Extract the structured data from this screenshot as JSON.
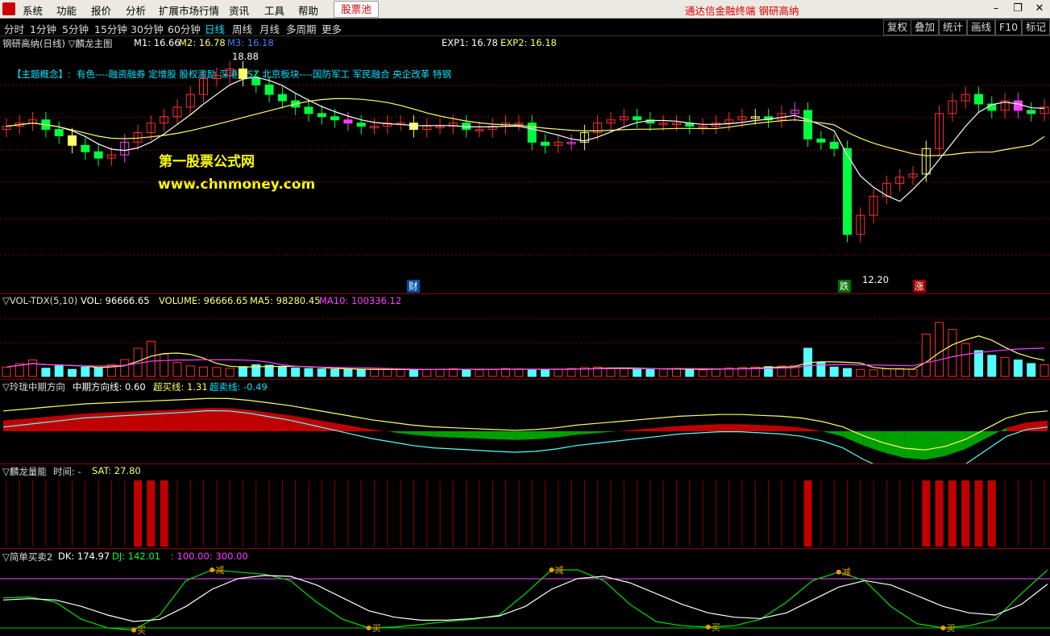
{
  "menu": {
    "items": [
      "系统",
      "功能",
      "报价",
      "分析",
      "扩展市场行情",
      "资讯",
      "工具",
      "帮助"
    ],
    "pool": "股票池",
    "right_title": "通达信金融终端  钢研高纳"
  },
  "periods": [
    "分时",
    "1分钟",
    "5分钟",
    "15分钟",
    "30分钟",
    "60分钟",
    "日线",
    "周线",
    "月线",
    "多周期",
    "更多"
  ],
  "active_period": "日线",
  "right_buttons": [
    "复权",
    "叠加",
    "统计",
    "画线",
    "F10",
    "标记"
  ],
  "main": {
    "title": "钢研高纳(日线) ▽麟龙主图",
    "m1": "M1: 16.66",
    "m2": "M2: 16.78",
    "m3": "M3: 16.18",
    "exp1": "EXP1: 16.78",
    "exp2": "EXP2: 16.18",
    "concept_label": "【主题概念】:",
    "concept_text": "有色----融资融券 定增股 股权激励 深港通SZ 北京板块----国防军工 军民融合 央企改革 特钢",
    "high_marker": "18.88",
    "low_marker": "12.20",
    "watermark1": "第一股票公式网",
    "watermark2": "www.chnmoney.com",
    "tags": [
      "财",
      "跌",
      "涨"
    ]
  },
  "volume": {
    "title": "▽VOL-TDX(5,10)",
    "vol": "VOL: 96666.65",
    "volume": "VOLUME: 96666.65",
    "ma5": "MA5: 98280.45",
    "ma10": "MA10: 100336.12"
  },
  "direction": {
    "title": "▽玲珑中期方向",
    "mid": "中期方向线: 0.60",
    "overbuy": "超买线: 1.31",
    "oversell": "超卖线: -0.49"
  },
  "energy": {
    "title": "▽麟龙量能",
    "time": "时间: -",
    "sat": "SAT: 27.80"
  },
  "simple": {
    "title": "▽简单买卖2",
    "dk": "DK: 174.97",
    "dj": "DJ: 142.01",
    "v1": ": 100.00",
    "v2": ": 300.00",
    "buy": "买",
    "sell": "减"
  },
  "colors": {
    "up": "#ff3030",
    "down": "#00ff40",
    "vol_down": "#54ffff",
    "ma_white": "#ffffff",
    "ma_yellow": "#ffff66",
    "ma_magenta": "#ff40ff",
    "grid": "#8a0000",
    "bg": "#000000"
  },
  "chart_data": {
    "type": "candlestick",
    "close": [
      16.8,
      16.9,
      17.0,
      16.7,
      16.5,
      16.2,
      16.0,
      15.8,
      15.9,
      16.3,
      16.6,
      16.9,
      17.1,
      17.4,
      17.8,
      18.3,
      18.4,
      18.6,
      18.3,
      18.1,
      17.8,
      17.6,
      17.4,
      17.2,
      17.1,
      17.0,
      16.9,
      16.8,
      16.8,
      16.9,
      16.9,
      16.7,
      16.8,
      16.8,
      16.9,
      16.7,
      16.7,
      16.8,
      16.9,
      16.9,
      16.3,
      16.2,
      16.3,
      16.3,
      16.6,
      16.9,
      17.0,
      17.1,
      17.0,
      16.9,
      16.9,
      16.9,
      16.8,
      16.8,
      16.9,
      17.0,
      17.1,
      17.1,
      17.0,
      17.2,
      17.3,
      16.4,
      16.3,
      16.1,
      13.4,
      14.0,
      14.6,
      15.0,
      15.2,
      15.3,
      16.1,
      17.2,
      17.6,
      17.8,
      17.5,
      17.3,
      17.6,
      17.3,
      17.2,
      17.4
    ],
    "series": [
      {
        "name": "VOL",
        "values": [
          40,
          55,
          70,
          35,
          45,
          30,
          40,
          38,
          50,
          72,
          120,
          150,
          95,
          60,
          45,
          40,
          38,
          35,
          42,
          50,
          48,
          40,
          36,
          34,
          32,
          30,
          30,
          28,
          30,
          32,
          30,
          28,
          30,
          31,
          33,
          30,
          28,
          30,
          34,
          32,
          30,
          28,
          30,
          34,
          38,
          40,
          36,
          32,
          30,
          30,
          32,
          34,
          30,
          28,
          32,
          36,
          38,
          40,
          42,
          44,
          46,
          120,
          60,
          40,
          34,
          30,
          28,
          32,
          34,
          30,
          180,
          230,
          200,
          140,
          110,
          90,
          80,
          70,
          55,
          50
        ]
      },
      {
        "name": "中期方向线",
        "values": [
          0.6,
          0.7,
          0.8,
          0.9,
          1.0,
          1.05,
          1.1,
          1.15,
          1.2,
          1.25,
          1.31,
          1.3,
          1.2,
          1.05,
          0.9,
          0.7,
          0.5,
          0.3,
          0.1,
          -0.05,
          -0.2,
          -0.3,
          -0.35,
          -0.4,
          -0.45,
          -0.49,
          -0.45,
          -0.35,
          -0.2,
          -0.1,
          0.0,
          0.1,
          0.2,
          0.3,
          0.35,
          0.4,
          0.4,
          0.35,
          0.3,
          0.2,
          0.0,
          -0.3,
          -0.8,
          -1.2,
          -1.5,
          -1.6,
          -1.4,
          -1.0,
          -0.4,
          0.2,
          0.5,
          0.6
        ]
      },
      {
        "name": "DK",
        "values": [
          110,
          112,
          100,
          60,
          40,
          35,
          70,
          150,
          175,
          170,
          165,
          150,
          100,
          60,
          40,
          42,
          48,
          55,
          60,
          70,
          120,
          175,
          175,
          150,
          95,
          55,
          45,
          42,
          45,
          60,
          100,
          150,
          170,
          150,
          90,
          50,
          40,
          45,
          60,
          120,
          174.97
        ]
      },
      {
        "name": "DJ",
        "values": [
          105,
          108,
          105,
          90,
          70,
          55,
          60,
          90,
          130,
          155,
          162,
          160,
          140,
          110,
          80,
          65,
          58,
          58,
          62,
          68,
          90,
          130,
          155,
          160,
          145,
          120,
          95,
          75,
          65,
          62,
          75,
          105,
          135,
          150,
          140,
          115,
          90,
          75,
          70,
          95,
          142.01
        ]
      }
    ]
  }
}
